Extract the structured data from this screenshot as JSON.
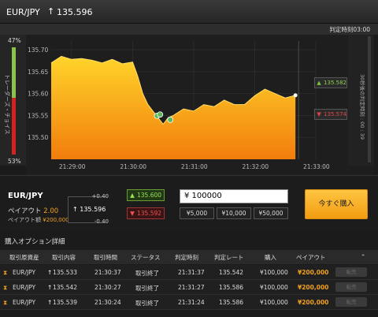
{
  "header": {
    "pair": "EUR/JPY",
    "rate": "135.596"
  },
  "expiry_label": "判定時刻03:00",
  "sentiment": {
    "high_pct": "47%",
    "low_pct": "53%",
    "label": "トレーダーズ・チョイス"
  },
  "chart_data": {
    "type": "area",
    "yticks": [
      "135.70",
      "135.65",
      "135.60",
      "135.55",
      "135.50"
    ],
    "xticks": [
      "21:29:00",
      "21:30:00",
      "21:31:00",
      "21:32:00",
      "21:33:00"
    ],
    "ylim": [
      135.45,
      135.72
    ],
    "x": [
      "21:28:40",
      "21:28:50",
      "21:29:00",
      "21:29:10",
      "21:29:20",
      "21:29:30",
      "21:29:40",
      "21:29:50",
      "21:30:00",
      "21:30:05",
      "21:30:10",
      "21:30:15",
      "21:30:20",
      "21:30:25",
      "21:30:30",
      "21:30:35",
      "21:30:40",
      "21:30:50",
      "21:31:00",
      "21:31:10",
      "21:31:20",
      "21:31:30",
      "21:31:40",
      "21:31:50",
      "21:32:00",
      "21:32:10",
      "21:32:20",
      "21:32:30",
      "21:32:40"
    ],
    "values": [
      135.67,
      135.685,
      135.678,
      135.68,
      135.676,
      135.67,
      135.678,
      135.668,
      135.672,
      135.64,
      135.6,
      135.575,
      135.56,
      135.545,
      135.53,
      135.545,
      135.55,
      135.565,
      135.56,
      135.575,
      135.57,
      135.585,
      135.575,
      135.575,
      135.595,
      135.61,
      135.6,
      135.59,
      135.596
    ],
    "series_color": "#f7a21b",
    "grid": true
  },
  "chart_markers": {
    "right_label": "30秒後の判定時刻 : 00 : 39"
  },
  "price_buttons": {
    "high": "135.582",
    "low": "135.574"
  },
  "trade": {
    "pair": "EUR/JPY",
    "payout_label": "ペイアウト",
    "payout_value": "2.00",
    "payout_amount_label": "ペイアウト額",
    "payout_amount": "¥200,000",
    "strike_plus": "+0.40",
    "strike_minus": "-0.40",
    "strike_value": "135.596",
    "high_button": "135.600",
    "low_button": "135.592",
    "amount": "¥ 100000",
    "quick_amounts": [
      "¥5,000",
      "¥10,000",
      "¥50,000"
    ],
    "buy_button": "今すぐ購入"
  },
  "details": {
    "title": "購入オプション詳細",
    "columns": [
      "取引原資産",
      "取引内容",
      "取引時間",
      "ステータス",
      "判定時刻",
      "判定レート",
      "購入",
      "ペイアウト"
    ],
    "rows": [
      {
        "asset": "EUR/JPY",
        "content": "135.533",
        "time": "21:30:37",
        "status": "取引終了",
        "expiry": "21:31:37",
        "rate": "135.542",
        "amount": "¥100,000",
        "payout": "¥200,000",
        "action": "転売"
      },
      {
        "asset": "EUR/JPY",
        "content": "135.542",
        "time": "21:30:27",
        "status": "取引終了",
        "expiry": "21:31:27",
        "rate": "135.586",
        "amount": "¥100,000",
        "payout": "¥200,000",
        "action": "転売"
      },
      {
        "asset": "EUR/JPY",
        "content": "135.539",
        "time": "21:30:24",
        "status": "取引終了",
        "expiry": "21:31:24",
        "rate": "135.586",
        "amount": "¥100,000",
        "payout": "¥200,000",
        "action": "転売"
      }
    ]
  }
}
